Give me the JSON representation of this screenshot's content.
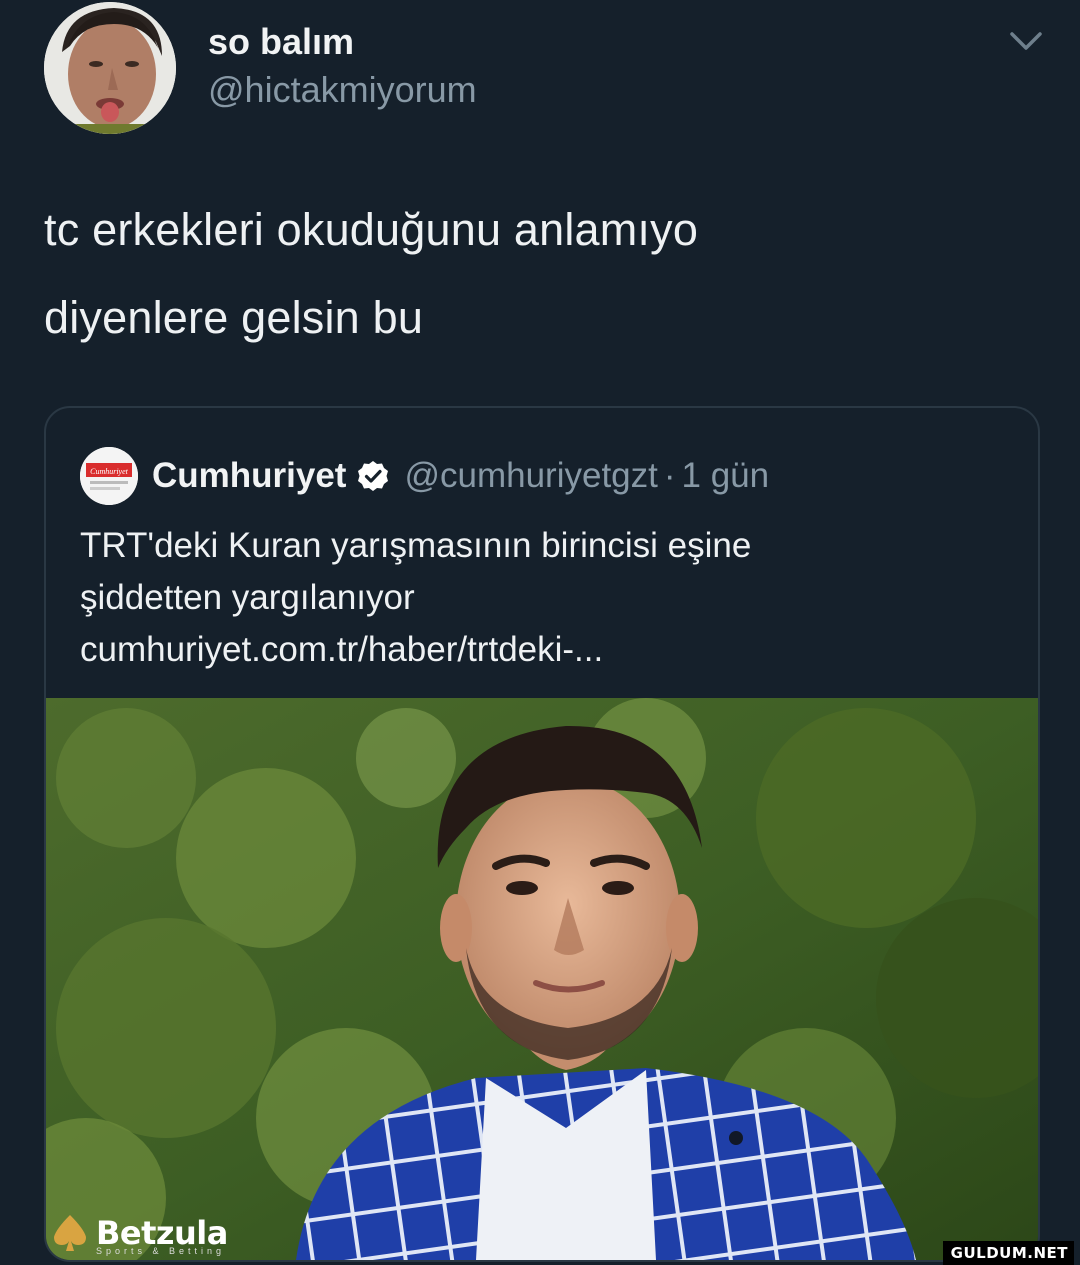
{
  "tweet": {
    "author": {
      "display_name": "so balım",
      "handle": "@hictakmiyorum"
    },
    "menu_icon": "chevron-down-icon",
    "text_lines": [
      "tc erkekleri okuduğunu anlamıyo",
      "diyenlere gelsin bu"
    ]
  },
  "quoted_tweet": {
    "author": {
      "display_name": "Cumhuriyet",
      "handle": "@cumhuriyetgzt",
      "verified": true
    },
    "separator": "·",
    "time": "1 gün",
    "text_lines": [
      "TRT'deki Kuran yarışmasının birincisi eşine",
      "şiddetten yargılanıyor",
      "cumhuriyet.com.tr/haber/trtdeki-..."
    ],
    "avatar_logo_text": "Cumhuriyet"
  },
  "watermarks": {
    "betzula": "Betzula",
    "betzula_sub": "Sports & Betting",
    "site": "GULDUM.NET"
  },
  "colors": {
    "background": "#15202b",
    "secondary_text": "#8899a6",
    "verified_badge": "#ffffff"
  }
}
